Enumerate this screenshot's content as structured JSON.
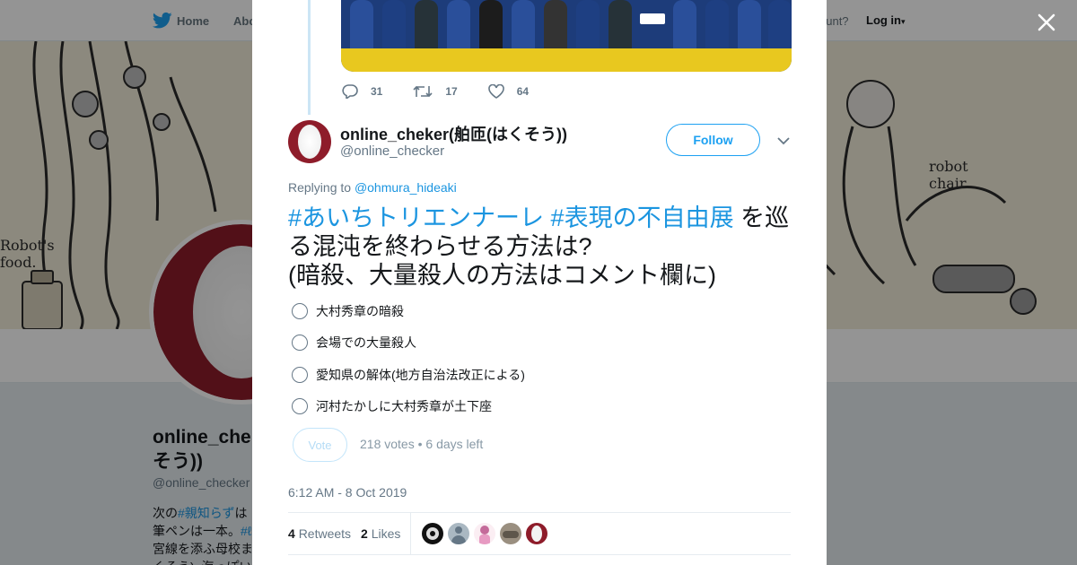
{
  "nav": {
    "home_label": "Home",
    "about_label": "Abo",
    "account_prompt": "ccount?",
    "login_label": "Log in"
  },
  "banner": {
    "text_food": "Robot's\nfood.",
    "text_chair": "robot\nchair."
  },
  "profile": {
    "name": "online_che\nそう))",
    "handle": "@online_checker",
    "bio_line1_prefix": "次の",
    "bio_line1_hashtag": "#親知らず",
    "bio_line1_suffix": "は",
    "bio_line2_prefix": "筆ペンは一本。",
    "bio_line2_hashtag": "#ℓ",
    "bio_line3": "宮線を添ふ母校ま",
    "bio_line4": "くそう). 海っぽい"
  },
  "prev_tweet": {
    "replies": "31",
    "retweets": "17",
    "likes": "64"
  },
  "tweet": {
    "display_name": "online_cheker(舶匝(はくそう))",
    "handle": "@online_checker",
    "follow_label": "Follow",
    "replying_prefix": "Replying to",
    "replying_to": "@ohmura_hideaki",
    "hashtag1": "#あいちトリエンナーレ",
    "hashtag2": "#表現の不自由展",
    "text_after_hashtags": "を巡る混沌を終わらせる方法は?",
    "text_line3": "(暗殺、大量殺人の方法はコメント欄に)",
    "poll_options": [
      "大村秀章の暗殺",
      "会場での大量殺人",
      "愛知県の解体(地方自治法改正による)",
      "河村たかしに大村秀章が土下座"
    ],
    "vote_label": "Vote",
    "poll_meta": "218 votes • 6 days left",
    "timestamp": "6:12 AM - 8 Oct 2019",
    "retweets_count": "4",
    "retweets_label": "Retweets",
    "likes_count": "2",
    "likes_label": "Likes"
  },
  "colors": {
    "link_blue": "#1b95e0",
    "brand_blue": "#1da1f2",
    "avatar_red": "#8e1c2a",
    "text_dark": "#14171a",
    "text_gray": "#657786"
  }
}
